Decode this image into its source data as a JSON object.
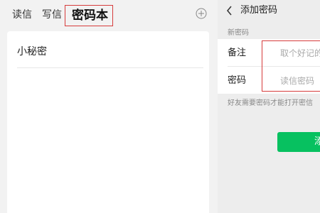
{
  "left": {
    "tabs": {
      "read": "读信",
      "write": "写信",
      "password_book": "密码本"
    },
    "items": [
      "小秘密"
    ]
  },
  "right": {
    "nav": {
      "title": "添加密码"
    },
    "section_label": "新密码",
    "fields": {
      "note": {
        "label": "备注",
        "placeholder": "取个好记的"
      },
      "password": {
        "label": "密码",
        "placeholder": "读信密码"
      }
    },
    "hint": "好友需要密码才能打开密信",
    "button_label": "添"
  },
  "colors": {
    "accent_green": "#07c160",
    "highlight_red": "#d63b3b"
  }
}
